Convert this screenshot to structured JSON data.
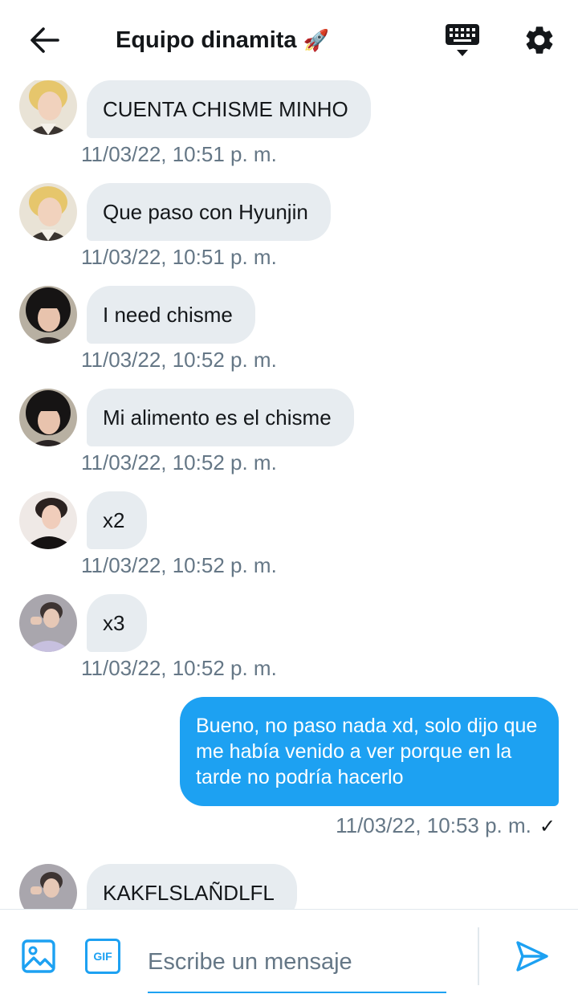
{
  "header": {
    "title": "Equipo dinamita",
    "title_emoji": "🚀",
    "back_icon": "arrow-left-icon",
    "keyboard_icon": "keyboard-icon",
    "settings_icon": "gear-icon"
  },
  "incoming": [
    {
      "text": "CUENTA CHISME MINHO",
      "timestamp": "11/03/22, 10:51 p. m."
    },
    {
      "text": "Que paso con Hyunjin",
      "timestamp": "11/03/22, 10:51 p. m."
    },
    {
      "text": "I need chisme",
      "timestamp": "11/03/22, 10:52 p. m."
    },
    {
      "text": "Mi alimento es el chisme",
      "timestamp": "11/03/22, 10:52 p. m."
    },
    {
      "text": "x2",
      "timestamp": "11/03/22, 10:52 p. m."
    },
    {
      "text": "x3",
      "timestamp": "11/03/22, 10:52 p. m."
    }
  ],
  "outgoing": {
    "text": "Bueno, no paso nada xd, solo dijo que me había venido a ver porque en la tarde no podría hacerlo",
    "timestamp": "11/03/22, 10:53 p. m.",
    "status": "✓"
  },
  "last_incoming": {
    "text": "KAKFLSLAÑDLFL"
  },
  "composer": {
    "placeholder": "Escribe un mensaje",
    "gif_label": "GIF",
    "image_icon": "image-icon",
    "send_icon": "send-icon"
  },
  "colors": {
    "accent": "#1da1f2",
    "bubble_in": "#e7ecf0",
    "timestamp": "#657786",
    "text": "#14171a"
  }
}
